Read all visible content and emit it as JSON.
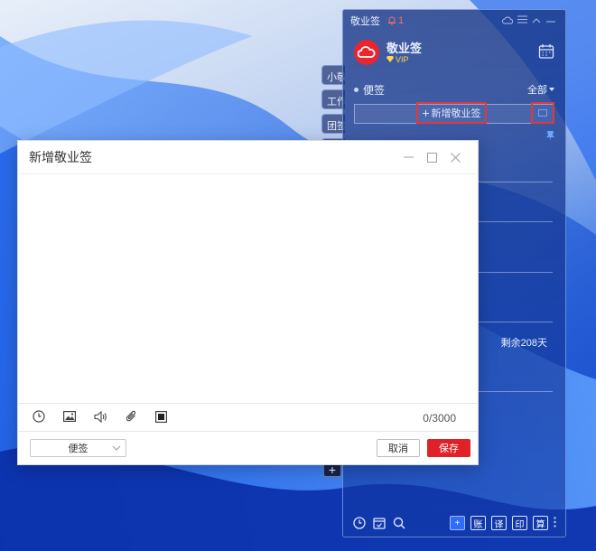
{
  "app": {
    "window_title": "敬业签",
    "notice_count": "1",
    "name": "敬业签",
    "badge": "VIP",
    "section_label": "便签",
    "filter_label": "全部",
    "new_note_label": "新增敬业签",
    "remaining_text": "剩余208天"
  },
  "side_tabs": [
    "小敬",
    "工作",
    "团签",
    ""
  ],
  "side_add": "+",
  "toolbar_boxes": [
    "+",
    "账",
    "译",
    "印",
    "算"
  ],
  "dialog": {
    "title": "新增敬业签",
    "editor_value": "",
    "char_count": "0/3000",
    "category": "便签",
    "cancel_label": "取消",
    "save_label": "保存"
  },
  "colors": {
    "accent_red": "#e02128",
    "highlight_red": "#e0383d",
    "panel_blue": "#163484"
  }
}
